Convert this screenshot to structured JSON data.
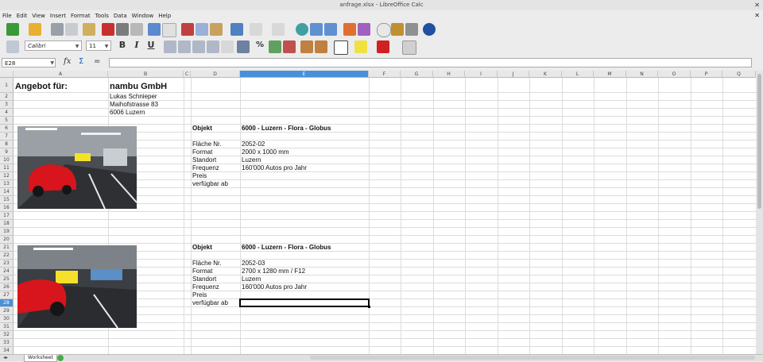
{
  "window": {
    "title": "anfrage.xlsx - LibreOffice Calc",
    "close_glyph": "✕"
  },
  "menu": [
    "File",
    "Edit",
    "View",
    "Insert",
    "Format",
    "Tools",
    "Data",
    "Window",
    "Help"
  ],
  "toolbar2": {
    "font_name": "Calibri",
    "font_size": "11",
    "bold": "B",
    "italic": "I",
    "underline": "U",
    "percent": "%",
    "dec_add": ".000",
    "dec_rem": ".000"
  },
  "formula": {
    "cell_ref": "E28",
    "value": "",
    "fx": "fx",
    "sum": "Σ",
    "equals": "="
  },
  "columns": [
    "A",
    "B",
    "C",
    "D",
    "E",
    "F",
    "G",
    "H",
    "I",
    "J",
    "K",
    "L",
    "M",
    "N",
    "O",
    "P",
    "Q"
  ],
  "rows": [
    "1",
    "2",
    "3",
    "4",
    "5",
    "6",
    "7",
    "8",
    "9",
    "10",
    "11",
    "12",
    "13",
    "14",
    "15",
    "16",
    "17",
    "18",
    "19",
    "20",
    "21",
    "22",
    "23",
    "24",
    "25",
    "26",
    "27",
    "28",
    "29",
    "30",
    "31",
    "32",
    "33",
    "34"
  ],
  "active": {
    "column": "E",
    "row": "28"
  },
  "header_block": {
    "a1": "Angebot für:",
    "b1": "nambu GmbH",
    "b2": "Lukas Schnieper",
    "b3": "Maihofstrasse 83",
    "b4": "6006 Luzern"
  },
  "offer1": {
    "objekt_label": "Objekt",
    "objekt_value": "6000 - Luzern - Flora - Globus",
    "flaeche_label": "Fläche Nr.",
    "flaeche_value": "2052-02",
    "format_label": "Format",
    "format_value": "2000 x 1000 mm",
    "standort_label": "Standort",
    "standort_value": "Luzern",
    "frequenz_label": "Frequenz",
    "frequenz_value": "160'000 Autos pro Jahr",
    "preis_label": "Preis",
    "verf_label": "verfügbar ab"
  },
  "offer2": {
    "objekt_label": "Objekt",
    "objekt_value": "6000 - Luzern - Flora - Globus",
    "flaeche_label": "Fläche Nr.",
    "flaeche_value": "2052-03",
    "format_label": "Format",
    "format_value": "2700 x 1280 mm / F12",
    "standort_label": "Standort",
    "standort_value": "Luzern",
    "frequenz_label": "Frequenz",
    "frequenz_value": "160'000 Autos pro Jahr",
    "preis_label": "Preis",
    "verf_label": "verfügbar ab"
  },
  "sheet_tab": "Worksheet",
  "colors": {
    "active_header": "#4a90d9",
    "photo_red_car": "#d8141c",
    "billboard_yellow": "#f5e12a"
  }
}
